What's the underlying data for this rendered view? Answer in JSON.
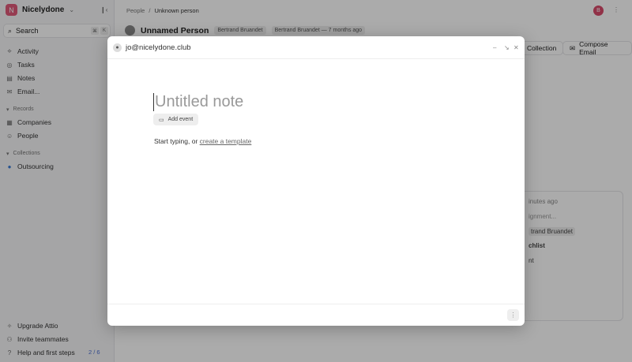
{
  "workspace": {
    "initial": "N",
    "name": "Nicelydone"
  },
  "search": {
    "label": "Search",
    "k1": "⌘",
    "k2": "K"
  },
  "nav": [
    {
      "icon": "⟡",
      "label": "Activity"
    },
    {
      "icon": "◎",
      "label": "Tasks"
    },
    {
      "icon": "▤",
      "label": "Notes"
    },
    {
      "icon": "✉",
      "label": "Email..."
    }
  ],
  "records": {
    "title": "Records",
    "items": [
      {
        "icon": "▦",
        "label": "Companies"
      },
      {
        "icon": "☺",
        "label": "People"
      }
    ]
  },
  "collections": {
    "title": "Collections",
    "items": [
      {
        "label": "Outsourcing"
      }
    ]
  },
  "bottom": [
    {
      "icon": "✧",
      "label": "Upgrade Attio"
    },
    {
      "icon": "⚇",
      "label": "Invite teammates"
    },
    {
      "icon": "?",
      "label": "Help and first steps",
      "badge": "2 / 6"
    }
  ],
  "breadcrumb": {
    "parent": "People",
    "current": "Unknown person"
  },
  "user": {
    "initial": "B"
  },
  "record": {
    "name": "Unnamed Person",
    "tag1": "Bertrand Bruandet",
    "tag2": "Bertrand Bruandet — 7 months ago"
  },
  "actions": {
    "collection": "Collection",
    "compose": "Compose Email"
  },
  "card": {
    "time": "inutes ago",
    "line1": "ignment...",
    "line2": "trand Bruandet",
    "line3": "chlist",
    "line4": "nt"
  },
  "modal": {
    "email": "jo@nicelydone.club",
    "title_placeholder": "Untitled note",
    "add_event": "Add event",
    "hint": "Start typing, or ",
    "hint_link": "create a template"
  }
}
